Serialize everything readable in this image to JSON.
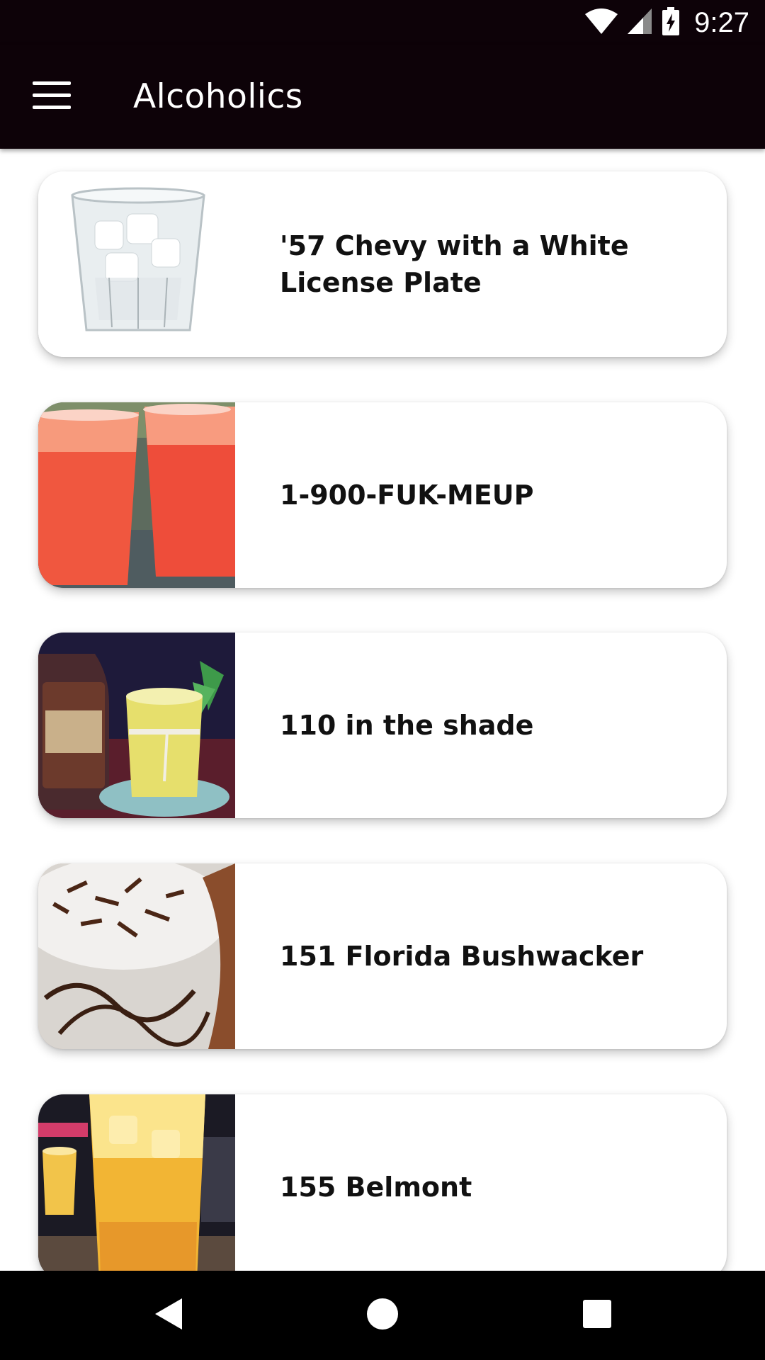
{
  "status_bar": {
    "time": "9:27",
    "icons": [
      "wifi-icon",
      "cell-signal-icon",
      "battery-charging-icon"
    ]
  },
  "app_bar": {
    "title": "Alcoholics",
    "menu_icon": "hamburger-menu-icon"
  },
  "drinks": [
    {
      "name": "'57 Chevy with a White License Plate"
    },
    {
      "name": "1-900-FUK-MEUP"
    },
    {
      "name": "110 in the shade"
    },
    {
      "name": "151 Florida Bushwacker"
    },
    {
      "name": "155 Belmont"
    }
  ],
  "nav_bar": {
    "icons": [
      "back-icon",
      "home-icon",
      "recents-icon"
    ]
  },
  "colors": {
    "app_bar_bg": "#0d0208",
    "card_bg": "#ffffff",
    "text": "#111111"
  }
}
